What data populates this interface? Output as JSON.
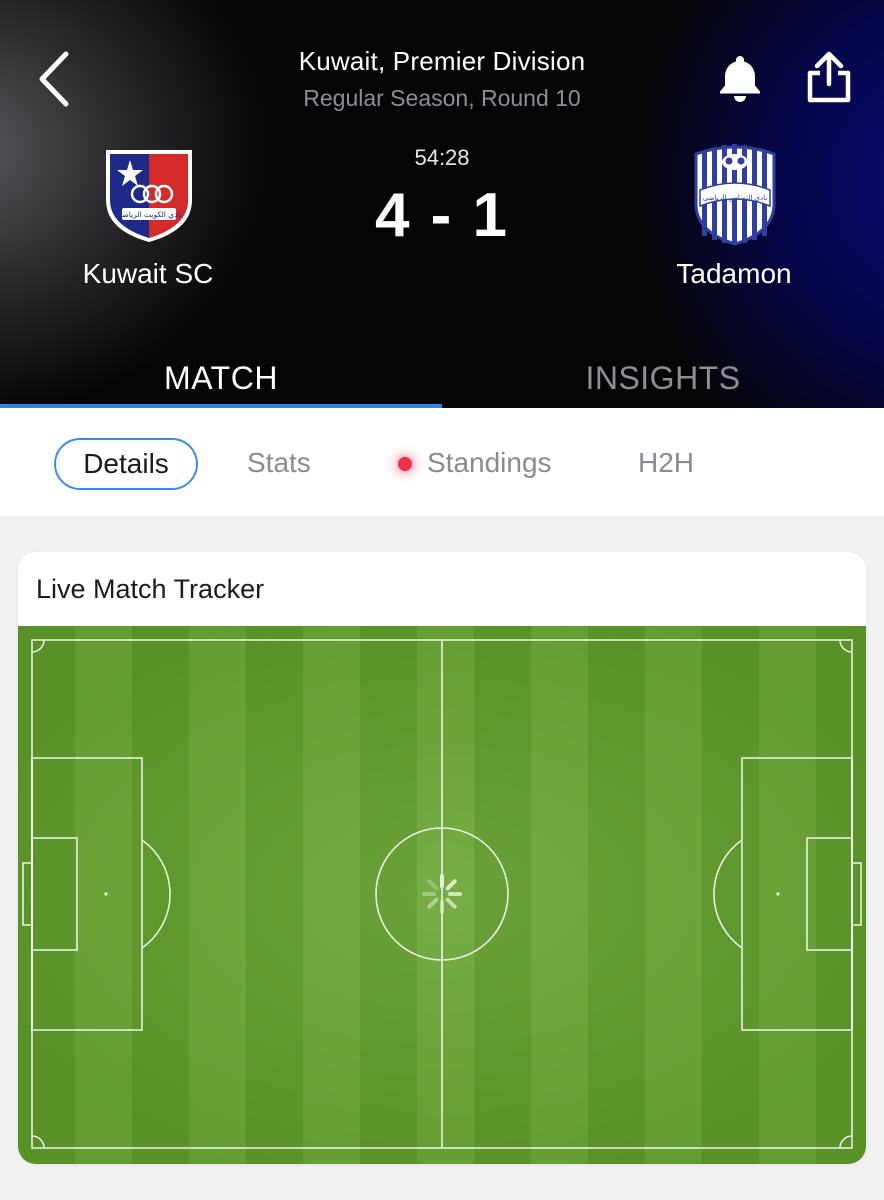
{
  "header": {
    "league": "Kuwait, Premier Division",
    "round": "Regular Season, Round 10",
    "clock": "54:28",
    "score": "4 - 1",
    "home_team": "Kuwait SC",
    "away_team": "Tadamon",
    "home_crest_text": "نادي الكويت الرياضي",
    "away_crest_text": "نادي التضامن الرياضي",
    "icons": [
      "back-chevron-icon",
      "bell-icon",
      "share-icon"
    ]
  },
  "tabs": [
    {
      "label": "MATCH",
      "active": true
    },
    {
      "label": "INSIGHTS",
      "active": false
    }
  ],
  "subtabs": [
    {
      "label": "Details",
      "active": true
    },
    {
      "label": "Stats",
      "active": false
    },
    {
      "label": "Standings",
      "active": false,
      "live": true
    },
    {
      "label": "H2H",
      "active": false
    }
  ],
  "tracker": {
    "title": "Live Match Tracker",
    "icon": "loading-spinner-icon"
  },
  "colors": {
    "accent": "#2e86de",
    "live_dot": "#f0304a",
    "pitch_dark": "#5d9a28",
    "pitch_light": "#6aa635",
    "kuwait_red": "#d42a2a",
    "kuwait_blue": "#1d2a8a",
    "tadamon_blue": "#2e3f9e"
  }
}
